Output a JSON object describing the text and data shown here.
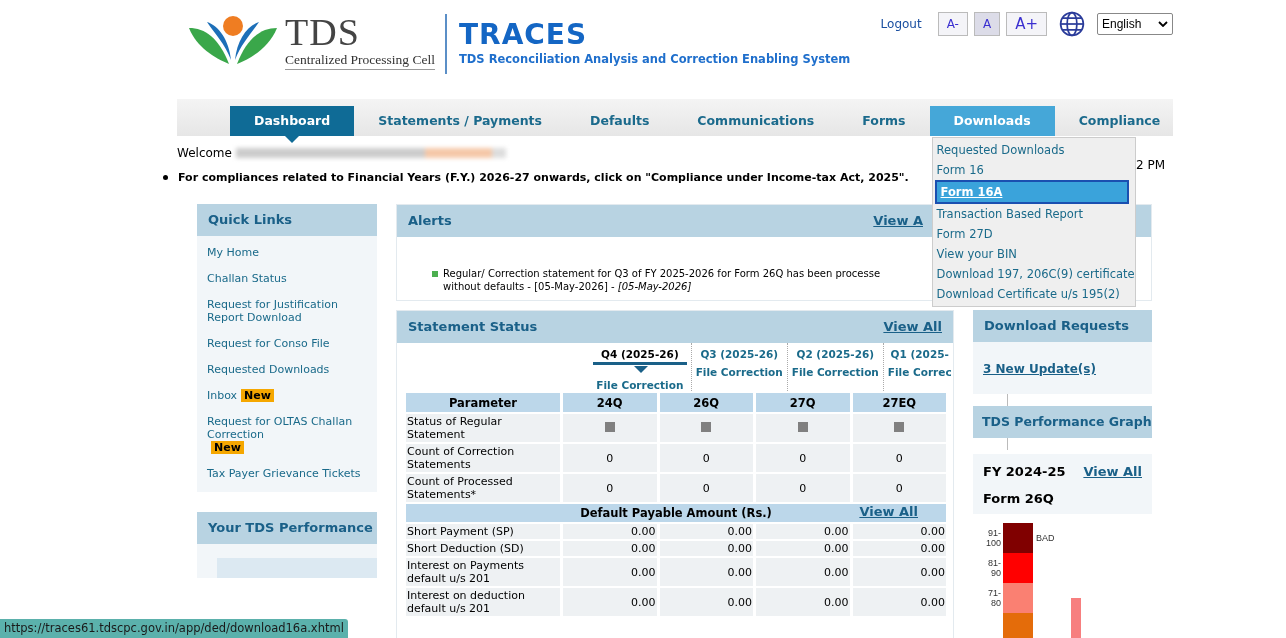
{
  "header": {
    "logo_text": "TDS",
    "logo_subtitle": "Centralized Processing Cell",
    "title": "TRACES",
    "subtitle": "TDS Reconciliation Analysis and Correction Enabling System"
  },
  "top_links": {
    "logout": "Logout",
    "font_buttons": [
      {
        "label": "A-",
        "selected": false
      },
      {
        "label": "A",
        "selected": true
      },
      {
        "label": "A+",
        "selected": false
      }
    ],
    "language": "English"
  },
  "nav": [
    {
      "label": "Dashboard",
      "selected": true,
      "expanded": false
    },
    {
      "label": "Statements / Payments",
      "selected": false,
      "expanded": false
    },
    {
      "label": "Defaults",
      "selected": false,
      "expanded": false
    },
    {
      "label": "Communications",
      "selected": false,
      "expanded": false
    },
    {
      "label": "Forms",
      "selected": false,
      "expanded": false
    },
    {
      "label": "Downloads",
      "selected": false,
      "expanded": true,
      "menu": [
        {
          "label": "Requested Downloads",
          "selected": false
        },
        {
          "label": "Form 16",
          "selected": false
        },
        {
          "label": "Form 16A",
          "selected": true
        },
        {
          "label": "Transaction Based Report",
          "selected": false
        },
        {
          "label": "Form 27D",
          "selected": false
        },
        {
          "label": "View your BIN",
          "selected": false
        },
        {
          "label": "Download 197, 206C(9) certificate",
          "selected": false
        },
        {
          "label": "Download Certificate u/s 195(2)",
          "selected": false
        }
      ]
    },
    {
      "label": "Compliance",
      "selected": false,
      "expanded": false
    }
  ],
  "welcome": {
    "label": "Welcome",
    "time_fragment": "2 PM"
  },
  "notice": "For compliances related to Financial Years (F.Y.) 2026-27 onwards, click on \"Compliance under Income-tax Act, 2025\".",
  "quick_links": {
    "title": "Quick Links",
    "items": [
      {
        "label": "My Home"
      },
      {
        "label": "Challan Status"
      },
      {
        "label": "Request for Justification Report Download"
      },
      {
        "label": "Request for Conso File"
      },
      {
        "label": "Requested Downloads"
      },
      {
        "label": "Inbox",
        "badge": "New"
      },
      {
        "label": "Request for OLTAS Challan Correction",
        "badge": "New"
      },
      {
        "label": "Tax Payer Grievance Tickets"
      }
    ]
  },
  "tds_performance": {
    "title": "Your TDS Performance"
  },
  "alerts": {
    "title": "Alerts",
    "link": "View A",
    "items": [
      {
        "line1": "Regular/ Correction statement for Q3 of FY 2025-2026 for Form 26Q has been processe",
        "line2": "without defaults - [05-May-2026] - *[05-May-2026]*"
      }
    ]
  },
  "statement_status": {
    "title": "Statement Status",
    "link": "View All",
    "quarters": [
      {
        "label": "Q4 (2025-26)",
        "link": "File Correction",
        "selected": true
      },
      {
        "label": "Q3 (2025-26)",
        "link": "File Correction",
        "selected": false
      },
      {
        "label": "Q2 (2025-26)",
        "link": "File Correction",
        "selected": false
      },
      {
        "label": "Q1 (2025-",
        "link": "File Correc",
        "selected": false
      }
    ],
    "columns": [
      "Parameter",
      "24Q",
      "26Q",
      "27Q",
      "27EQ"
    ],
    "rows": [
      {
        "kind": "status",
        "label": "Status of Regular Statement"
      },
      {
        "kind": "count",
        "label": "Count of Correction Statements",
        "cells": [
          "0",
          "0",
          "0",
          "0"
        ]
      },
      {
        "kind": "count",
        "label": "Count of Processed Statements*",
        "cells": [
          "0",
          "0",
          "0",
          "0"
        ]
      },
      {
        "kind": "section",
        "title": "Default Payable Amount (Rs.)",
        "link": "View All"
      },
      {
        "kind": "amount",
        "label": "Short Payment (SP)",
        "cells": [
          "0.00",
          "0.00",
          "0.00",
          "0.00"
        ]
      },
      {
        "kind": "amount",
        "label": "Short Deduction (SD)",
        "cells": [
          "0.00",
          "0.00",
          "0.00",
          "0.00"
        ]
      },
      {
        "kind": "amount",
        "label": "Interest on Payments default u/s 201",
        "cells": [
          "0.00",
          "0.00",
          "0.00",
          "0.00"
        ]
      },
      {
        "kind": "amount",
        "label": "Interest on deduction default u/s 201",
        "cells": [
          "0.00",
          "0.00",
          "0.00",
          "0.00"
        ]
      }
    ]
  },
  "download_requests": {
    "title": "Download Requests",
    "link": "3 New Update(s)"
  },
  "performance_graph": {
    "title": "TDS Performance Graph",
    "fy": "FY 2024-25",
    "link": "View All",
    "form": "Form 26Q",
    "top_label": "BAD",
    "bands": [
      {
        "label": "91-100",
        "color": "#800000"
      },
      {
        "label": "81-90",
        "color": "#ff0000"
      },
      {
        "label": "71-80",
        "color": "#fa8072"
      },
      {
        "color": "#e46c0a"
      }
    ]
  },
  "status_bar": "https://traces61.tdscpc.gov.in/app/ded/download16a.xhtml"
}
